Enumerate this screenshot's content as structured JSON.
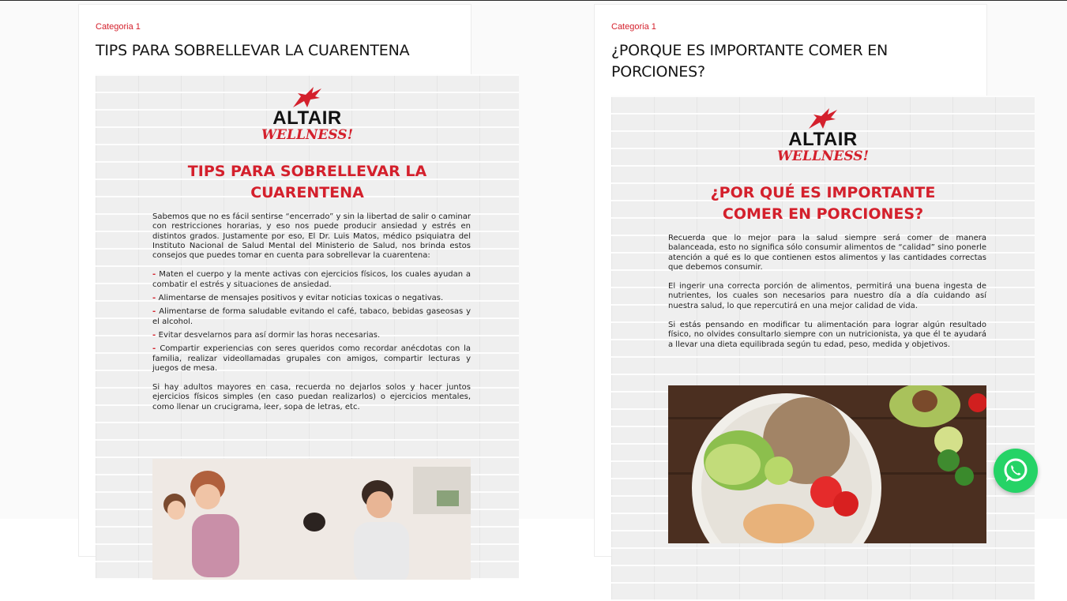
{
  "posts": [
    {
      "category": "Categoria 1",
      "title": "TIPS PARA SOBRELLEVAR LA CUARENTENA",
      "poster": {
        "logo_word": "ALTAIR",
        "logo_sub": "WELLNESS!",
        "heading_line1": "TIPS PARA SOBRELLEVAR LA",
        "heading_line2": "CUARENTENA",
        "intro": "Sabemos que no es fácil sentirse “encerrado” y sin la libertad de salir o caminar con restricciones horarias, y eso nos puede producir ansiedad y estrés en distintos grados. Justamente por eso, El Dr. Luis Matos, médico psiquiatra del Instituto Nacional de Salud Mental del Ministerio de Salud, nos brinda estos consejos que puedes tomar en cuenta para sobrellevar la cuarentena:",
        "bullets": [
          "Maten el cuerpo y la mente activas con ejercicios físicos, los cuales ayudan a combatir el estrés y situaciones de ansiedad.",
          "Alimentarse de mensajes positivos y evitar noticias toxicas o negativas.",
          "Alimentarse de forma saludable evitando el café, tabaco, bebidas gaseosas y el alcohol.",
          "Evitar desvelarnos para así dormir las horas necesarias.",
          "Compartir experiencias con seres queridos como recordar anécdotas con la familia, realizar videollamadas grupales con amigos, compartir lecturas y juegos de mesa."
        ],
        "closing": "Si hay adultos mayores en casa, recuerda no dejarlos solos y hacer juntos ejercicios físicos simples (en caso puedan realizarlos) o ejercicios mentales, como llenar un crucigrama, leer, sopa de letras, etc."
      }
    },
    {
      "category": "Categoria 1",
      "title": "¿PORQUE ES IMPORTANTE COMER EN PORCIONES?",
      "poster": {
        "logo_word": "ALTAIR",
        "logo_sub": "WELLNESS!",
        "heading_line1": "¿POR QUÉ ES IMPORTANTE",
        "heading_line2": "COMER EN PORCIONES?",
        "paragraphs": [
          "Recuerda que lo mejor para la salud siempre será comer de manera balanceada, esto no significa sólo consumir alimentos de “calidad” sino ponerle atención a qué es lo que contienen estos alimentos y las cantidades correctas que debemos consumir.",
          "El ingerir una correcta porción de alimentos, permitirá una buena ingesta de nutrientes, los cuales son necesarios para nuestro día a día cuidando así nuestra salud, lo que repercutirá en una mejor calidad de vida.",
          "Si estás pensando en modificar tu alimentación para lograr algún resultado físico, no olvides consultarlo siempre con un nutricionista, ya que él te ayudará a llevar una dieta equilibrada según tu edad, peso, medida y objetivos."
        ]
      }
    }
  ],
  "whatsapp_icon": "whatsapp-icon",
  "colors": {
    "accent": "#d4202c",
    "whatsapp": "#25d366"
  }
}
